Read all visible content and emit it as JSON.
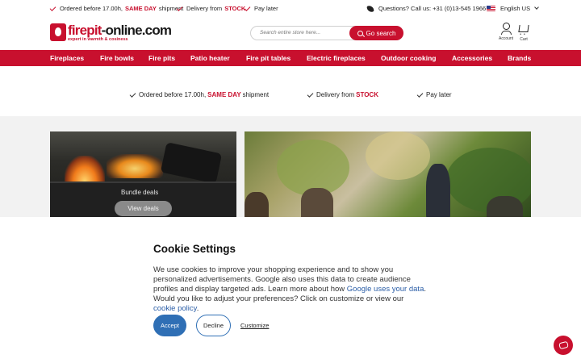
{
  "topbar": {
    "usp1_pre": "Ordered before 17.00h,",
    "usp1_bold": "SAME DAY",
    "usp1_post": "shipment",
    "usp2_pre": "Delivery from",
    "usp2_bold": "STOCK",
    "usp3": "Pay later",
    "contact": "Questions? Call us: +31 (0)13-545 1966",
    "language": "English US"
  },
  "header": {
    "logo_main": "firepit",
    "logo_rest": "-online.com",
    "logo_tagline": "expert in warmth & cosiness",
    "search_placeholder": "Search entire store here...",
    "search_button": "Go search",
    "account_label": "Account",
    "cart_label": "Cart"
  },
  "nav": {
    "items": [
      "Fireplaces",
      "Fire bowls",
      "Fire pits",
      "Patio heater",
      "Fire pit tables",
      "Electric fireplaces",
      "Outdoor cooking",
      "Accessories",
      "Brands"
    ]
  },
  "usps": {
    "usp1_pre": "Ordered before 17.00h,",
    "usp1_bold": "SAME DAY",
    "usp1_post": "shipment",
    "usp2_pre": "Delivery from",
    "usp2_bold": "STOCK",
    "usp3": "Pay later"
  },
  "banner": {
    "card1_label": "Bundle deals",
    "card1_button": "View deals"
  },
  "cookie": {
    "title": "Cookie Settings",
    "text_1": "We use cookies to improve your shopping experience and to show you personalized advertisements. Google also uses this data to create audience profiles and display targeted ads. Learn more about how",
    "link_1": "Google uses your data",
    "text_2": ". Would you like to adjust your preferences? Click on customize or view our",
    "link_2": "cookie policy",
    "text_3": ".",
    "accept": "Accept",
    "decline": "Decline",
    "customize": "Customize"
  },
  "colors": {
    "brand_red": "#c8102e",
    "accept_blue": "#2f6fb5",
    "link_blue": "#2b5ea7"
  },
  "icons": [
    "check-icon",
    "phone-icon",
    "us-flag-icon",
    "chevron-down-icon",
    "search-icon",
    "user-icon",
    "cart-icon",
    "chat-icon"
  ]
}
